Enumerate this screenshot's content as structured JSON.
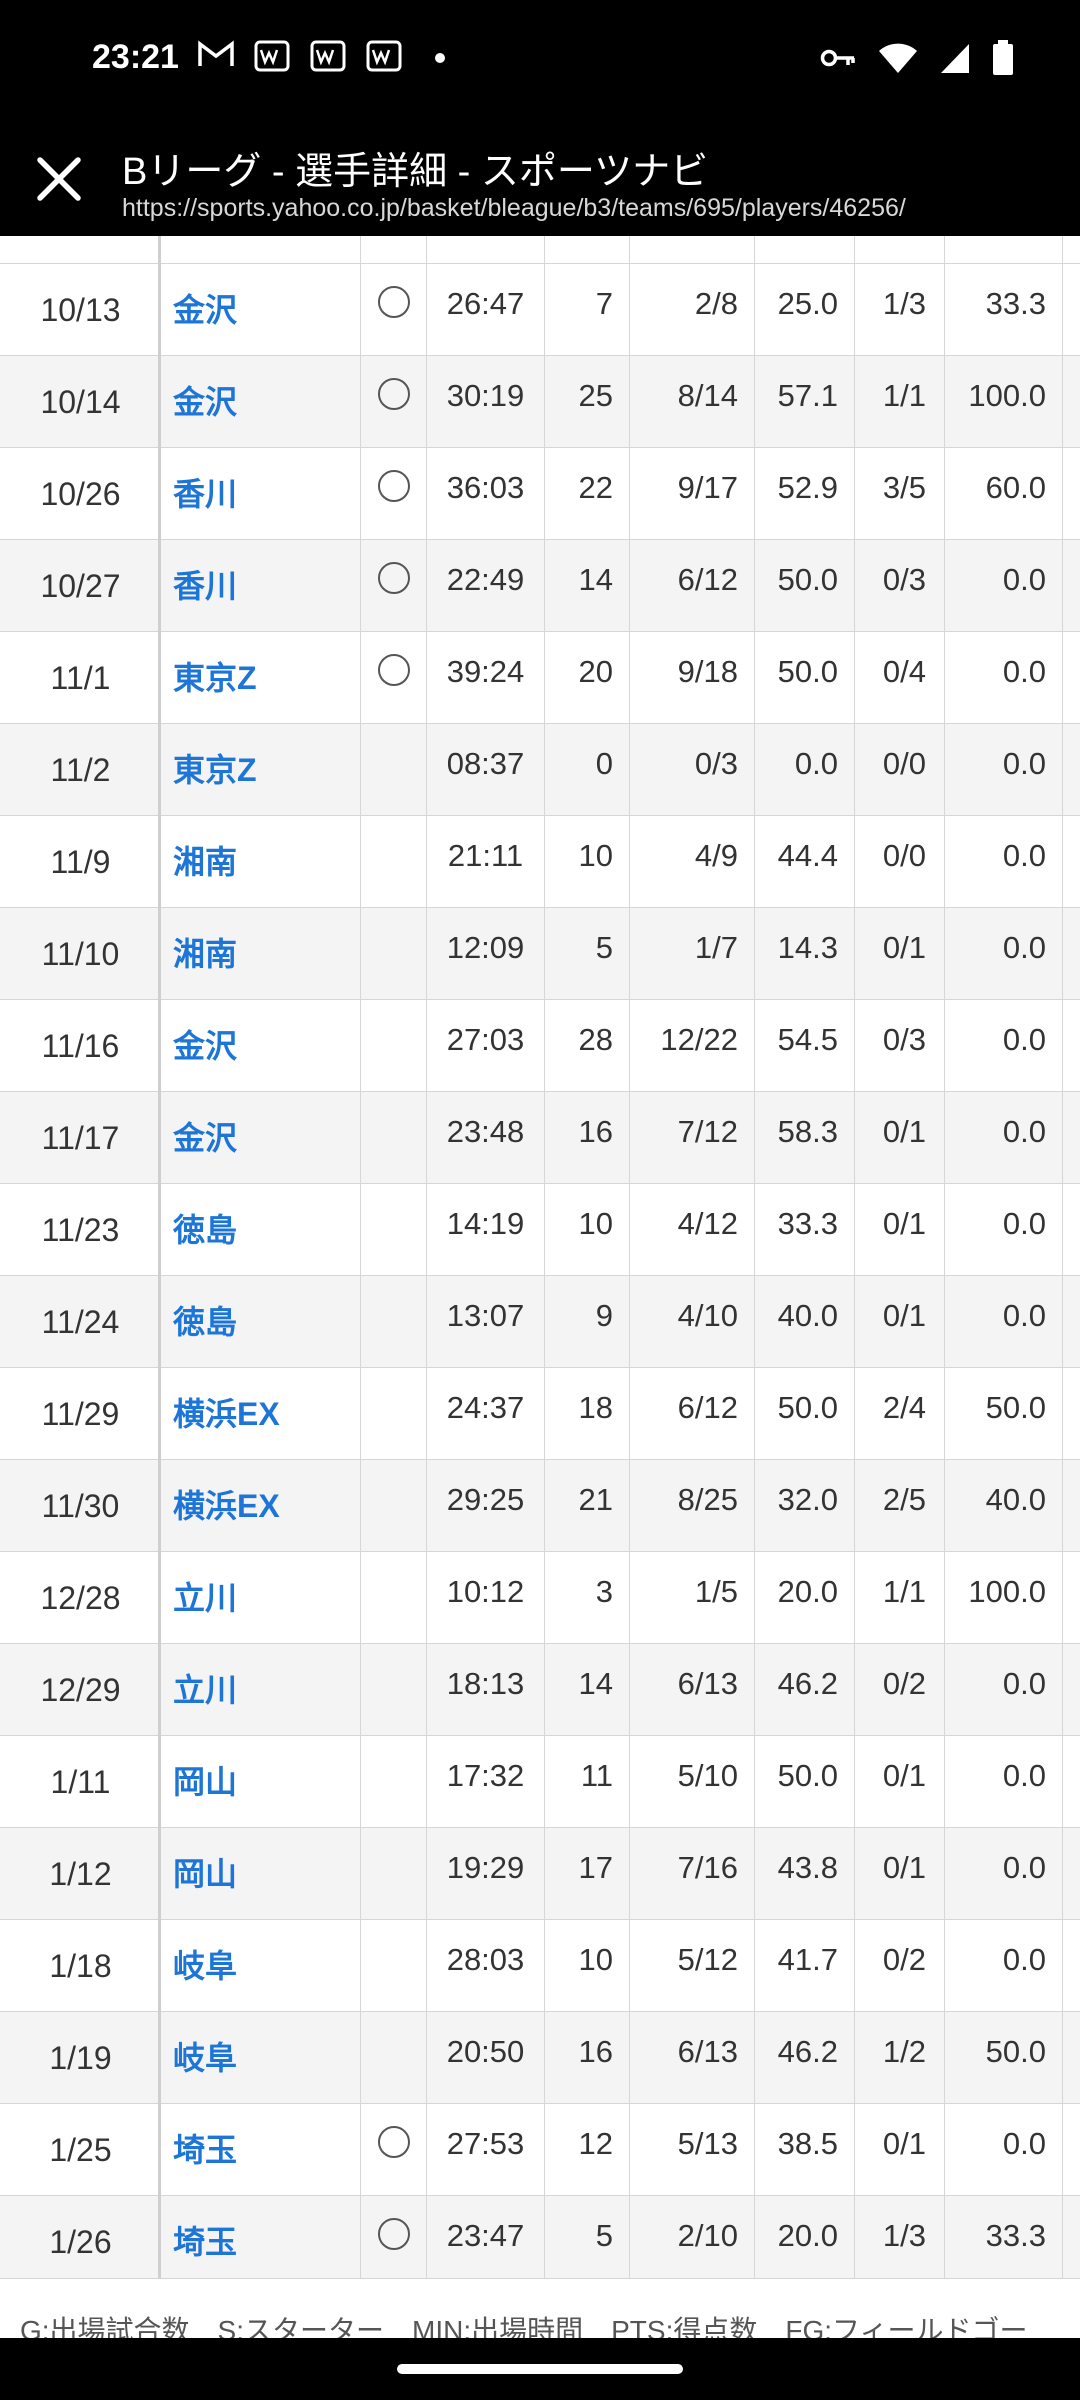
{
  "status_bar": {
    "time": "23:21",
    "notification_icons": [
      "gmail-icon",
      "mobile-app-icon",
      "mobile-app-icon",
      "mobile-app-icon",
      "dot-icon"
    ],
    "system_icons": [
      "vpn-key-icon",
      "wifi-icon",
      "signal-icon",
      "battery-icon"
    ]
  },
  "browser": {
    "title": "Bリーグ - 選手詳細 - スポーツナビ",
    "url": "https://sports.yahoo.co.jp/basket/bleague/b3/teams/695/players/46256/"
  },
  "games": [
    {
      "date": "10/13",
      "team": "金沢",
      "starter": true,
      "min": "26:47",
      "pts": "7",
      "fg": "2/8",
      "fgp": "25.0",
      "tp": "1/3",
      "tpp": "33.3"
    },
    {
      "date": "10/14",
      "team": "金沢",
      "starter": true,
      "min": "30:19",
      "pts": "25",
      "fg": "8/14",
      "fgp": "57.1",
      "tp": "1/1",
      "tpp": "100.0"
    },
    {
      "date": "10/26",
      "team": "香川",
      "starter": true,
      "min": "36:03",
      "pts": "22",
      "fg": "9/17",
      "fgp": "52.9",
      "tp": "3/5",
      "tpp": "60.0"
    },
    {
      "date": "10/27",
      "team": "香川",
      "starter": true,
      "min": "22:49",
      "pts": "14",
      "fg": "6/12",
      "fgp": "50.0",
      "tp": "0/3",
      "tpp": "0.0"
    },
    {
      "date": "11/1",
      "team": "東京Z",
      "starter": true,
      "min": "39:24",
      "pts": "20",
      "fg": "9/18",
      "fgp": "50.0",
      "tp": "0/4",
      "tpp": "0.0"
    },
    {
      "date": "11/2",
      "team": "東京Z",
      "starter": false,
      "min": "08:37",
      "pts": "0",
      "fg": "0/3",
      "fgp": "0.0",
      "tp": "0/0",
      "tpp": "0.0"
    },
    {
      "date": "11/9",
      "team": "湘南",
      "starter": false,
      "min": "21:11",
      "pts": "10",
      "fg": "4/9",
      "fgp": "44.4",
      "tp": "0/0",
      "tpp": "0.0"
    },
    {
      "date": "11/10",
      "team": "湘南",
      "starter": false,
      "min": "12:09",
      "pts": "5",
      "fg": "1/7",
      "fgp": "14.3",
      "tp": "0/1",
      "tpp": "0.0"
    },
    {
      "date": "11/16",
      "team": "金沢",
      "starter": false,
      "min": "27:03",
      "pts": "28",
      "fg": "12/22",
      "fgp": "54.5",
      "tp": "0/3",
      "tpp": "0.0"
    },
    {
      "date": "11/17",
      "team": "金沢",
      "starter": false,
      "min": "23:48",
      "pts": "16",
      "fg": "7/12",
      "fgp": "58.3",
      "tp": "0/1",
      "tpp": "0.0"
    },
    {
      "date": "11/23",
      "team": "徳島",
      "starter": false,
      "min": "14:19",
      "pts": "10",
      "fg": "4/12",
      "fgp": "33.3",
      "tp": "0/1",
      "tpp": "0.0"
    },
    {
      "date": "11/24",
      "team": "徳島",
      "starter": false,
      "min": "13:07",
      "pts": "9",
      "fg": "4/10",
      "fgp": "40.0",
      "tp": "0/1",
      "tpp": "0.0"
    },
    {
      "date": "11/29",
      "team": "横浜EX",
      "starter": false,
      "min": "24:37",
      "pts": "18",
      "fg": "6/12",
      "fgp": "50.0",
      "tp": "2/4",
      "tpp": "50.0"
    },
    {
      "date": "11/30",
      "team": "横浜EX",
      "starter": false,
      "min": "29:25",
      "pts": "21",
      "fg": "8/25",
      "fgp": "32.0",
      "tp": "2/5",
      "tpp": "40.0"
    },
    {
      "date": "12/28",
      "team": "立川",
      "starter": false,
      "min": "10:12",
      "pts": "3",
      "fg": "1/5",
      "fgp": "20.0",
      "tp": "1/1",
      "tpp": "100.0"
    },
    {
      "date": "12/29",
      "team": "立川",
      "starter": false,
      "min": "18:13",
      "pts": "14",
      "fg": "6/13",
      "fgp": "46.2",
      "tp": "0/2",
      "tpp": "0.0"
    },
    {
      "date": "1/11",
      "team": "岡山",
      "starter": false,
      "min": "17:32",
      "pts": "11",
      "fg": "5/10",
      "fgp": "50.0",
      "tp": "0/1",
      "tpp": "0.0"
    },
    {
      "date": "1/12",
      "team": "岡山",
      "starter": false,
      "min": "19:29",
      "pts": "17",
      "fg": "7/16",
      "fgp": "43.8",
      "tp": "0/1",
      "tpp": "0.0"
    },
    {
      "date": "1/18",
      "team": "岐阜",
      "starter": false,
      "min": "28:03",
      "pts": "10",
      "fg": "5/12",
      "fgp": "41.7",
      "tp": "0/2",
      "tpp": "0.0"
    },
    {
      "date": "1/19",
      "team": "岐阜",
      "starter": false,
      "min": "20:50",
      "pts": "16",
      "fg": "6/13",
      "fgp": "46.2",
      "tp": "1/2",
      "tpp": "50.0"
    },
    {
      "date": "1/25",
      "team": "埼玉",
      "starter": true,
      "min": "27:53",
      "pts": "12",
      "fg": "5/13",
      "fgp": "38.5",
      "tp": "0/1",
      "tpp": "0.0"
    },
    {
      "date": "1/26",
      "team": "埼玉",
      "starter": true,
      "min": "23:47",
      "pts": "5",
      "fg": "2/10",
      "fgp": "20.0",
      "tp": "1/3",
      "tpp": "33.3"
    }
  ],
  "legend": "G:出場試合数　S:スターター　MIN:出場時間　PTS:得点数　FG:フィールドゴー",
  "colors": {
    "team_link": "#1d75d8",
    "alt_row": "#f4f4f4"
  }
}
